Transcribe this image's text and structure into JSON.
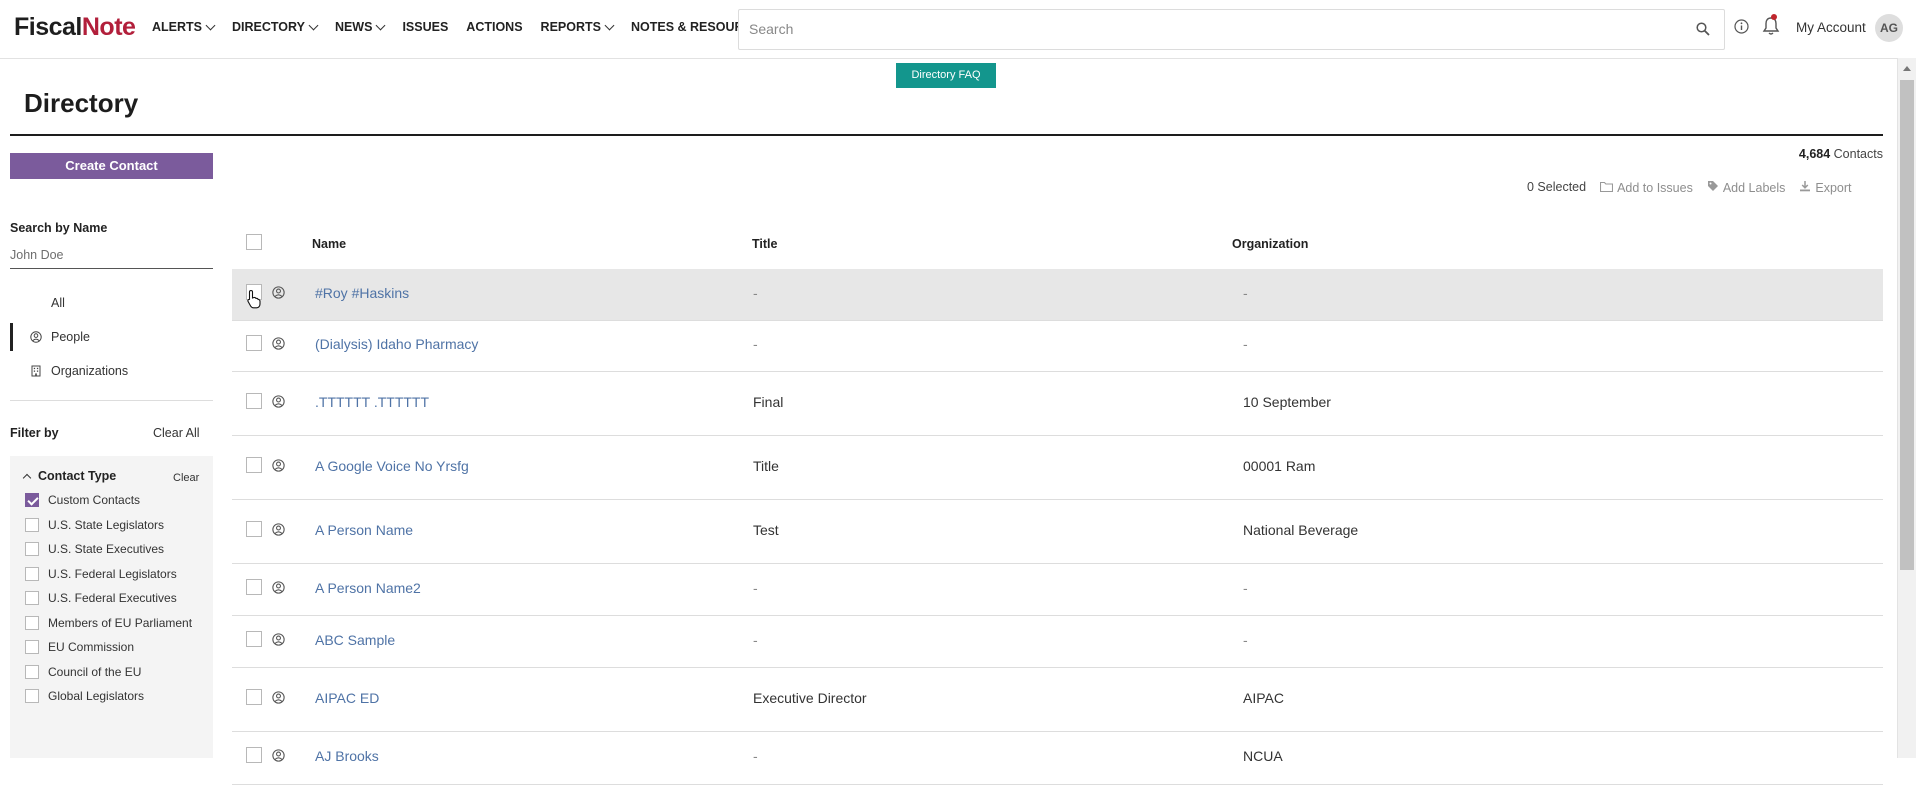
{
  "app": {
    "logo_part1": "Fiscal",
    "logo_part2": "Note"
  },
  "nav": {
    "items": [
      {
        "label": "ALERTS",
        "dropdown": true
      },
      {
        "label": "DIRECTORY",
        "dropdown": true
      },
      {
        "label": "NEWS",
        "dropdown": true
      },
      {
        "label": "ISSUES",
        "dropdown": false
      },
      {
        "label": "ACTIONS",
        "dropdown": false
      },
      {
        "label": "REPORTS",
        "dropdown": true
      },
      {
        "label": "NOTES & RESOURCES",
        "dropdown": true
      }
    ],
    "search_placeholder": "Search",
    "account_label": "My Account",
    "avatar_initials": "AG"
  },
  "page": {
    "faq_button": "Directory FAQ",
    "title": "Directory"
  },
  "sidebar": {
    "create_button": "Create Contact",
    "search_label": "Search by Name",
    "search_placeholder": "John Doe",
    "types": [
      {
        "label": "All",
        "icon": "none",
        "active": false
      },
      {
        "label": "People",
        "icon": "person-circle-icon",
        "active": true
      },
      {
        "label": "Organizations",
        "icon": "building-icon",
        "active": false
      }
    ],
    "filter_label": "Filter by",
    "clear_all": "Clear All",
    "contact_type": {
      "title": "Contact Type",
      "clear": "Clear",
      "options": [
        {
          "label": "Custom Contacts",
          "checked": true
        },
        {
          "label": "U.S. State Legislators",
          "checked": false
        },
        {
          "label": "U.S. State Executives",
          "checked": false
        },
        {
          "label": "U.S. Federal Legislators",
          "checked": false
        },
        {
          "label": "U.S. Federal Executives",
          "checked": false
        },
        {
          "label": "Members of EU Parliament",
          "checked": false
        },
        {
          "label": "EU Commission",
          "checked": false
        },
        {
          "label": "Council of the EU",
          "checked": false
        },
        {
          "label": "Global Legislators",
          "checked": false
        }
      ]
    }
  },
  "main": {
    "count_number": "4,684",
    "count_label": "Contacts",
    "selected": "0 Selected",
    "add_to_issues": "Add to Issues",
    "add_labels": "Add Labels",
    "export": "Export",
    "columns": {
      "name": "Name",
      "title": "Title",
      "organization": "Organization"
    },
    "rows": [
      {
        "name": "#Roy #Haskins",
        "title": "-",
        "organization": "-"
      },
      {
        "name": "(Dialysis) Idaho Pharmacy",
        "title": "-",
        "organization": "-"
      },
      {
        "name": ".TTTTTT .TTTTTT",
        "title": "Final",
        "organization": "10 September"
      },
      {
        "name": "A Google Voice No Yrsfg",
        "title": "Title",
        "organization": "00001 Ram"
      },
      {
        "name": "A Person Name",
        "title": "Test",
        "organization": "National Beverage"
      },
      {
        "name": "A Person Name2",
        "title": "-",
        "organization": "-"
      },
      {
        "name": "ABC Sample",
        "title": "-",
        "organization": "-"
      },
      {
        "name": "AIPAC ED",
        "title": "Executive Director",
        "organization": "AIPAC"
      },
      {
        "name": "AJ Brooks",
        "title": "-",
        "organization": "NCUA"
      }
    ]
  },
  "colors": {
    "brand_red": "#b21f3b",
    "faq_teal": "#13968d",
    "create_purple": "#7b5b9c",
    "link_blue": "#4f73a6"
  }
}
